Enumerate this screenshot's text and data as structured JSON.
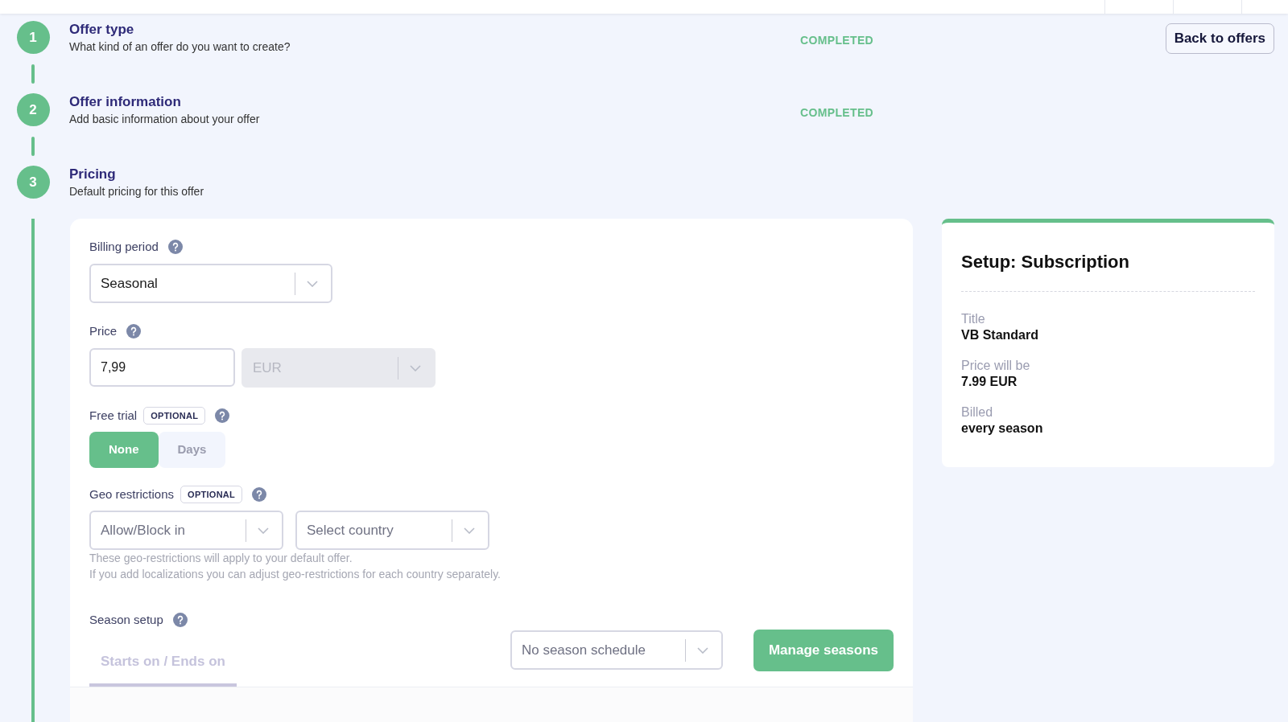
{
  "steps": [
    {
      "number": "1",
      "title": "Offer type",
      "subtitle": "What kind of an offer do you want to create?",
      "status": "COMPLETED"
    },
    {
      "number": "2",
      "title": "Offer information",
      "subtitle": "Add basic information about your offer",
      "status": "COMPLETED"
    },
    {
      "number": "3",
      "title": "Pricing",
      "subtitle": "Default pricing for this offer"
    }
  ],
  "back_button": "Back to offers",
  "pricing": {
    "billing_period": {
      "label": "Billing period",
      "value": "Seasonal"
    },
    "price": {
      "label": "Price",
      "value": "7,99",
      "currency": "EUR",
      "currency_disabled": true
    },
    "free_trial": {
      "label": "Free trial",
      "badge": "OPTIONAL",
      "options": [
        {
          "label": "None",
          "selected": true
        },
        {
          "label": "Days",
          "selected": false
        }
      ]
    },
    "geo_restrictions": {
      "label": "Geo restrictions",
      "badge": "OPTIONAL",
      "mode_placeholder": "Allow/Block in",
      "country_placeholder": "Select country",
      "hints": [
        "These geo-restrictions will apply to your default offer.",
        "If you add localizations you can adjust geo-restrictions for each country separately."
      ]
    },
    "season_setup": {
      "label": "Season setup",
      "tabs": [
        {
          "label": "Starts on / Ends on",
          "selected": true
        }
      ],
      "schedule": "No season schedule",
      "button": "Manage seasons"
    }
  },
  "summary": {
    "title": "Setup: Subscription",
    "items": [
      {
        "label": "Title",
        "value": "VB Standard"
      },
      {
        "label": "Price will be",
        "value": "7.99 EUR"
      },
      {
        "label": "Billed",
        "value": "every season"
      }
    ]
  }
}
